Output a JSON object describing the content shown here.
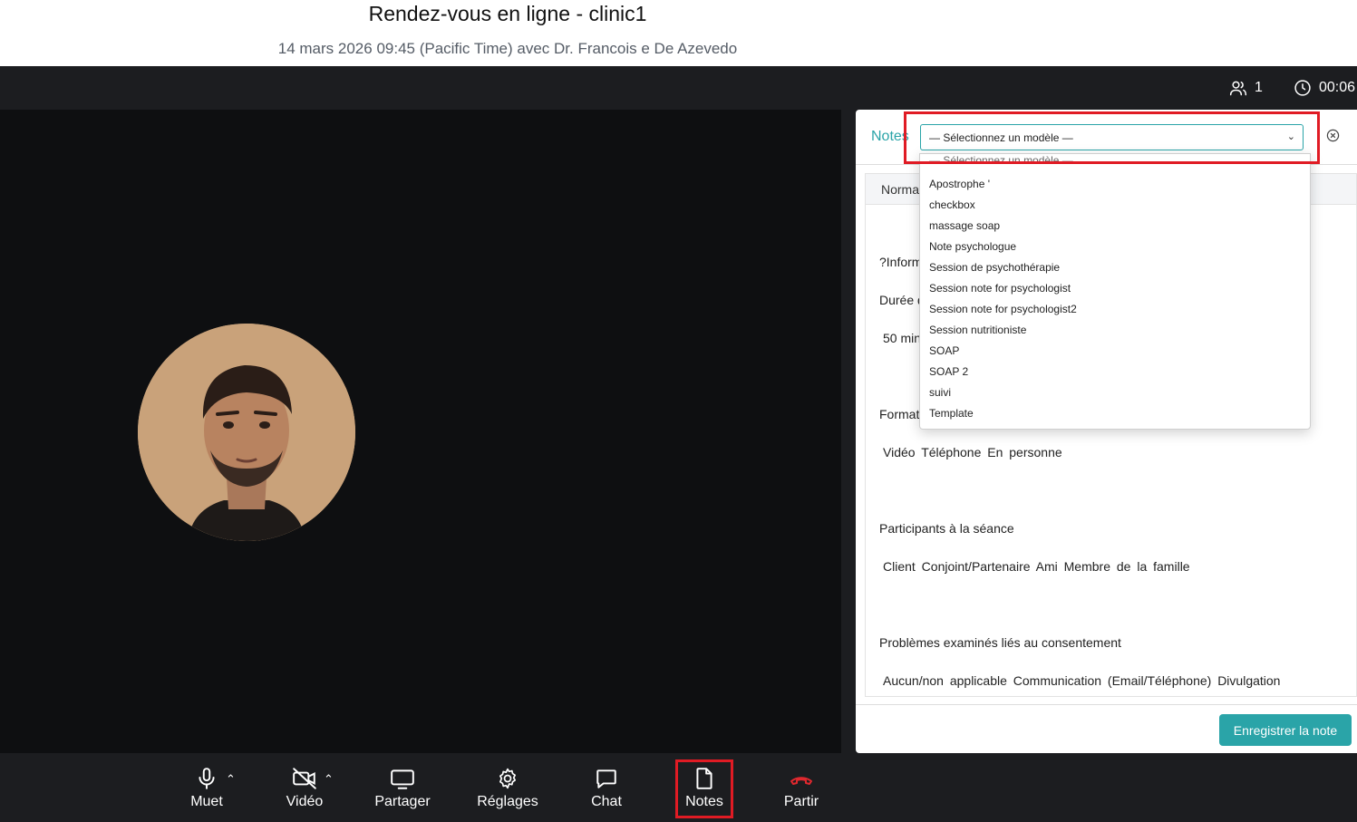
{
  "header": {
    "title": "Rendez-vous en ligne - clinic1",
    "subtitle": "14 mars 2026 09:45 (Pacific Time) avec Dr. Francois e De Azevedo"
  },
  "topbar": {
    "participants_count": "1",
    "timer": "00:06"
  },
  "notes_panel": {
    "title": "Notes",
    "select_value": "— Sélectionnez un modèle —",
    "editor_toolbar_label": "Normal",
    "editor_lines": [
      "?Inform",
      "Durée d",
      "50 min",
      "Format",
      "Vidéo   Téléphone   En personne",
      "Participants à la séance",
      "Client   Conjoint/Partenaire   Ami   Membre de la famille",
      "Problèmes examinés liés au consentement",
      "Aucun/non applicable   Communication (Email/Téléphone)   Divulgation"
    ],
    "save_label": "Enregistrer la note"
  },
  "dropdown": {
    "options": [
      "— Sélectionnez un modèle —",
      "Apostrophe '",
      "checkbox",
      "massage soap",
      "Note psychologue",
      "Session de psychothérapie",
      "Session note for psychologist",
      "Session note for psychologist2",
      "Session nutritioniste",
      "SOAP",
      "SOAP 2",
      "suivi",
      "Template"
    ]
  },
  "toolbar": {
    "mute": "Muet",
    "video": "Vidéo",
    "share": "Partager",
    "settings": "Réglages",
    "chat": "Chat",
    "notes": "Notes",
    "leave": "Partir"
  },
  "colors": {
    "accent": "#2aa4a8",
    "highlight": "#e01b24",
    "leave": "#e0282e",
    "stage": "#1c1d20"
  }
}
